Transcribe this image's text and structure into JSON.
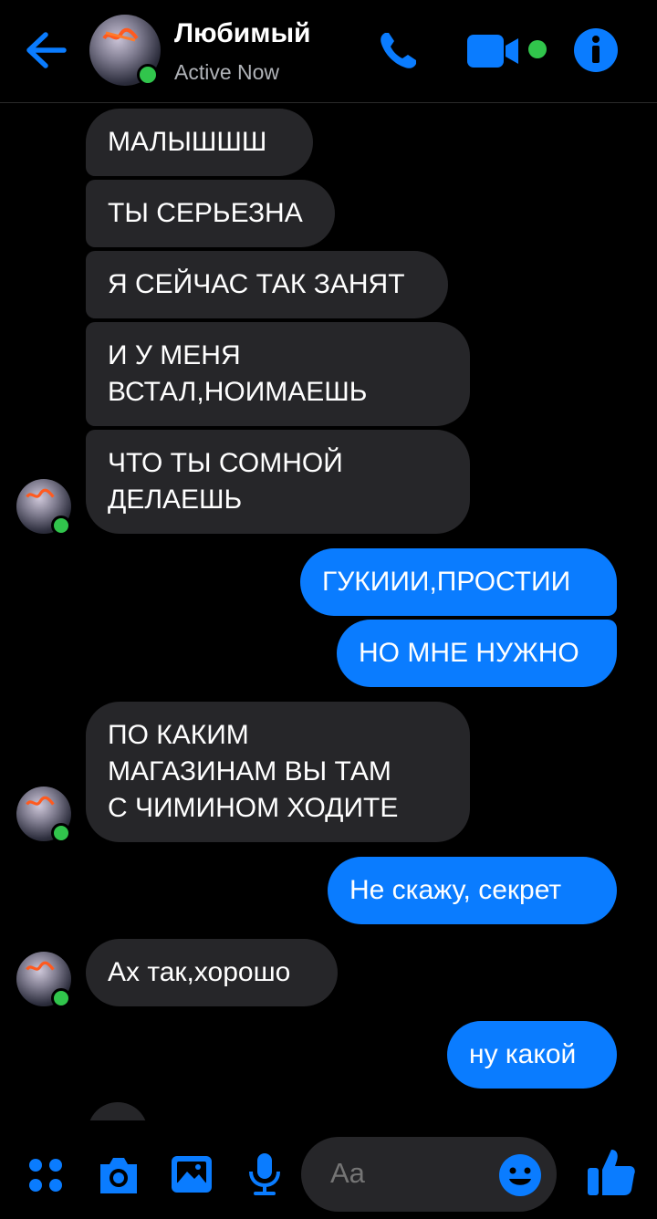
{
  "header": {
    "contact_name": "Любимый",
    "status": "Active Now"
  },
  "messages": [
    {
      "from": "them",
      "text": "МАЛЫШШШ"
    },
    {
      "from": "them",
      "text": "ТЫ СЕРЬЕЗНА"
    },
    {
      "from": "them",
      "text": "Я СЕЙЧАС ТАК ЗАНЯТ"
    },
    {
      "from": "them",
      "text": "И У МЕНЯ\nВСТАЛ,НОИМАЕШЬ"
    },
    {
      "from": "them",
      "text": "ЧТО ТЫ СОМНОЙ\nДЕЛАЕШЬ"
    },
    {
      "from": "me",
      "text": "ГУКИИИ,ПРОСТИИ"
    },
    {
      "from": "me",
      "text": "НО МНЕ НУЖНО"
    },
    {
      "from": "them",
      "text": "ПО КАКИМ\nМАГАЗИНАМ ВЫ ТАМ\nС ЧИМИНОМ  ХОДИТЕ"
    },
    {
      "from": "me",
      "text": "Не скажу, секрет"
    },
    {
      "from": "them",
      "text": "Ах так,хорошо"
    },
    {
      "from": "me",
      "text": "ну какой"
    }
  ],
  "composer": {
    "placeholder": "Aa"
  },
  "colors": {
    "accent": "#0a7cff",
    "received_bubble": "#262629",
    "online": "#31c54c",
    "background": "#000000"
  },
  "icons": {
    "back": "arrow-left-icon",
    "phone": "phone-icon",
    "video": "video-camera-icon",
    "info": "info-icon",
    "apps": "grid-dots-icon",
    "camera": "camera-icon",
    "gallery": "image-icon",
    "mic": "microphone-icon",
    "emoji": "smiley-icon",
    "like": "thumbs-up-icon"
  }
}
